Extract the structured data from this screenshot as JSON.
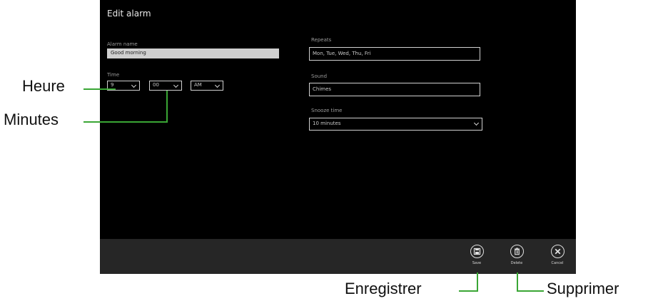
{
  "window": {
    "title": "Edit alarm"
  },
  "alarm_name": {
    "label": "Alarm name",
    "value": "Good morning"
  },
  "time": {
    "label": "Time",
    "hour": "9",
    "minutes": "00",
    "ampm": "AM"
  },
  "repeats": {
    "label": "Repeats",
    "value": "Mon, Tue, Wed, Thu, Fri"
  },
  "sound": {
    "label": "Sound",
    "value": "Chimes"
  },
  "snooze": {
    "label": "Snooze time",
    "value": "10 minutes"
  },
  "appbar": {
    "save": {
      "label": "Save",
      "icon": "save-icon"
    },
    "delete": {
      "label": "Delete",
      "icon": "trash-icon"
    },
    "cancel": {
      "label": "Cancel",
      "icon": "close-icon"
    }
  },
  "callouts": {
    "heure": "Heure",
    "minutes": "Minutes",
    "enregistrer": "Enregistrer",
    "supprimer": "Supprimer"
  },
  "colors": {
    "callout_line": "#3aa635",
    "background": "#000000",
    "appbar": "#262626"
  }
}
